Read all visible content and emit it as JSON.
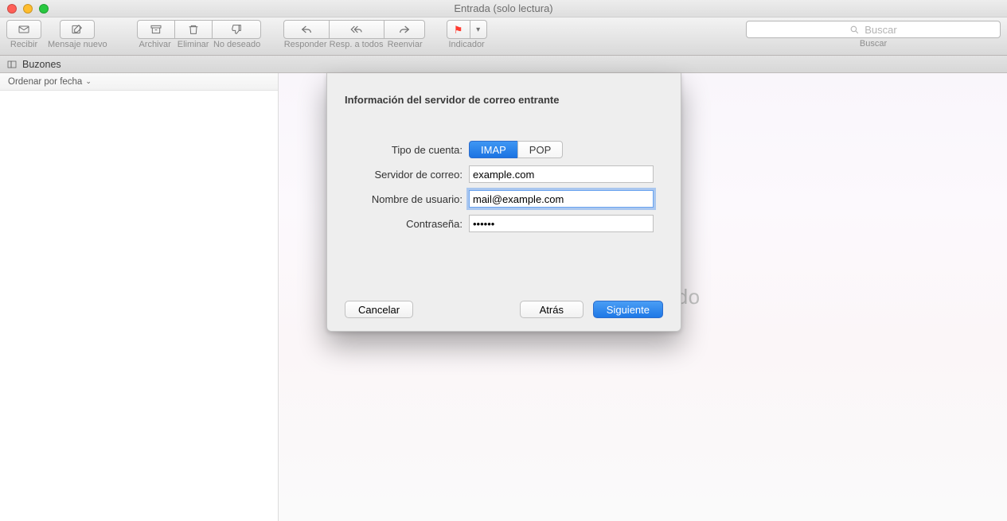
{
  "window": {
    "title": "Entrada (solo lectura)"
  },
  "toolbar": {
    "recibir": "Recibir",
    "nuevo": "Mensaje nuevo",
    "archivar": "Archivar",
    "eliminar": "Eliminar",
    "nodeseado": "No deseado",
    "responder": "Responder",
    "resp_todos": "Resp. a todos",
    "reenviar": "Reenviar",
    "indicador": "Indicador"
  },
  "search": {
    "placeholder": "Buscar",
    "label": "Buscar"
  },
  "secbar": {
    "buzones": "Buzones"
  },
  "sort": {
    "label": "Ordenar por fecha"
  },
  "placeholder_suffix": "eleccionado",
  "sheet": {
    "title": "Información del servidor de correo entrante",
    "labels": {
      "tipo": "Tipo de cuenta:",
      "servidor": "Servidor de correo:",
      "usuario": "Nombre de usuario:",
      "pass": "Contraseña:"
    },
    "account_types": {
      "imap": "IMAP",
      "pop": "POP"
    },
    "values": {
      "servidor": "example.com",
      "usuario": "mail@example.com",
      "pass": "••••••"
    },
    "buttons": {
      "cancel": "Cancelar",
      "back": "Atrás",
      "next": "Siguiente"
    }
  }
}
